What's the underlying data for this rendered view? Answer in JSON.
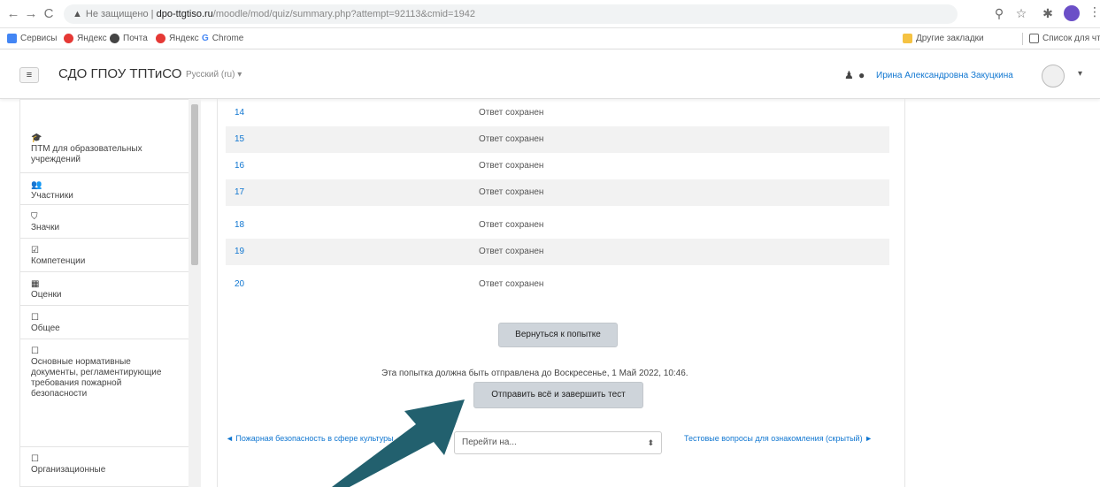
{
  "browser": {
    "url_warning": "Не защищено",
    "url_host": "dpo-ttgtiso.ru",
    "url_path": "/moodle/mod/quiz/summary.php?attempt=92113&cmid=1942",
    "bookmarks": [
      {
        "label": "Сервисы",
        "color": "#4285f4"
      },
      {
        "label": "Яндекс",
        "color": "#e53935"
      },
      {
        "label": "Почта",
        "color": "#444444"
      },
      {
        "label": "Яндекс",
        "color": "#e53935"
      },
      {
        "label": "Chrome",
        "color": "#4285f4"
      }
    ],
    "other_bookmarks": "Другие закладки",
    "reading_list": "Список для чтения"
  },
  "header": {
    "menu_icon": "hamburger-icon",
    "brand": "СДО ГПОУ ТПТиСО",
    "language": "Русский (ru) ▾",
    "user_name": "Ирина Александровна Закуцкина",
    "caret": "▾"
  },
  "sidebar": {
    "items": [
      {
        "icon": "graduation-cap-icon",
        "glyph": "🎓",
        "label": "ПТМ для образовательных учреждений"
      },
      {
        "icon": "users-icon",
        "glyph": "👥",
        "label": "Участники"
      },
      {
        "icon": "shield-icon",
        "glyph": "⛉",
        "label": "Значки"
      },
      {
        "icon": "checklist-icon",
        "glyph": "☑",
        "label": "Компетенции"
      },
      {
        "icon": "table-icon",
        "glyph": "▦",
        "label": "Оценки"
      },
      {
        "icon": "folder-icon",
        "glyph": "☐",
        "label": "Общее"
      },
      {
        "icon": "folder-icon",
        "glyph": "☐",
        "label": "Основные нормативные документы, регламентирующие требования пожарной безопасности"
      },
      {
        "icon": "folder-icon",
        "glyph": "☐",
        "label": "Организационные"
      }
    ]
  },
  "summary": {
    "rows": [
      {
        "num": "14",
        "status": "Ответ сохранен"
      },
      {
        "num": "15",
        "status": "Ответ сохранен"
      },
      {
        "num": "16",
        "status": "Ответ сохранен"
      },
      {
        "num": "17",
        "status": "Ответ сохранен"
      },
      {
        "num": "18",
        "status": "Ответ сохранен"
      },
      {
        "num": "19",
        "status": "Ответ сохранен"
      },
      {
        "num": "20",
        "status": "Ответ сохранен"
      }
    ],
    "return_button": "Вернуться к попытке",
    "deadline_text": "Эта попытка должна быть отправлена до Воскресенье, 1 Май 2022, 10:46.",
    "submit_button": "Отправить всё и завершить тест"
  },
  "footer_nav": {
    "prev_link": "◄ Пожарная безопасность в сфере культуры",
    "jump_placeholder": "Перейти на...",
    "jump_arrow": "⬍",
    "next_link": "Тестовые вопросы для ознакомления (скрытый) ►"
  },
  "annotation": {
    "arrow_color": "#22606e"
  }
}
